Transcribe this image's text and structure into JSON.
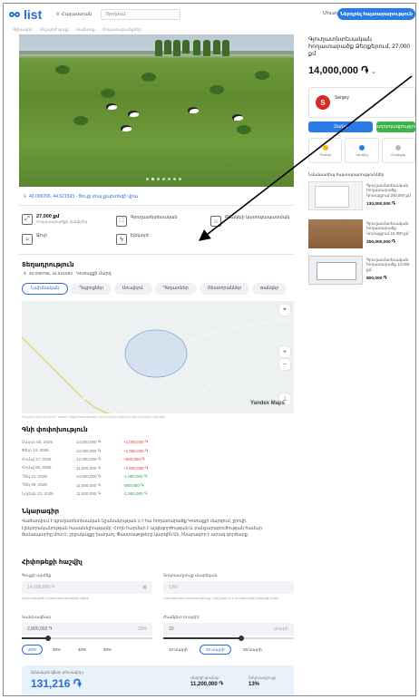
{
  "header": {
    "logo": "list",
    "location": "Հայաստան",
    "search_placeholder": "Որոնում",
    "login": "Մուտք",
    "post_button": "Ներդրել հայտարարություն"
  },
  "breadcrumbs": [
    "Գլխավոր",
    "Անշարժ գույք",
    "Վաճառք",
    "Հողատարածքներ"
  ],
  "coords_link": "40.099765, 44.621593 · Ցույց տալ քարտեզի վրա",
  "features": [
    {
      "title": "27,000 քմ",
      "sub": "Հողատարածքի մակերես"
    },
    {
      "title": "Գյուղատնտեսական",
      "sub": ""
    },
    {
      "title": "Բնակելի կառուցապատման",
      "sub": ""
    },
    {
      "title": "Ջուր",
      "sub": ""
    },
    {
      "title": "Էլեկտրէ",
      "sub": ""
    }
  ],
  "location_section": {
    "title": "Տեղադրություն",
    "address": "40.099765, 44.621593 · Կոտայքի մարզ",
    "chips": [
      "Նախնական",
      "Դպրոցներ",
      "Սուպերմ.",
      "Դեղատներ",
      "Ռեստորաններ",
      "Bանկեր"
    ],
    "map_brand": "Yandex Maps",
    "map_note": "Ինչպես նկատում եմ՝ Yandex Maps ծառայությունը հարմարավետ է տեղորոշելու համար"
  },
  "price_history": {
    "title": "Գնի փոփոխություն",
    "rows": [
      {
        "date": "Մարտ 05, 2026",
        "price": "14,000,000 ֏",
        "change": "+1,000,000 ֏",
        "dir": "up"
      },
      {
        "date": "Փետ 24, 2026",
        "price": "13,000,000 ֏",
        "change": "+1,000,000 ֏",
        "dir": "up"
      },
      {
        "date": "Հունվ 17, 2026",
        "price": "12,000,000 ֏",
        "change": "+500,000 ֏",
        "dir": "up"
      },
      {
        "date": "Հունվ 06, 2026",
        "price": "11,500,000 ֏",
        "change": "+1,500,000 ֏",
        "dir": "up"
      },
      {
        "date": "Դեկ 21, 2025",
        "price": "10,000,000 ֏",
        "change": "-1,000,000 ֏",
        "dir": "down"
      },
      {
        "date": "Դեկ 09, 2025",
        "price": "11,000,000 ֏",
        "change": "-500,000 ֏",
        "dir": "down"
      },
      {
        "date": "Նոյեմբ 22, 2025",
        "price": "11,500,000 ֏",
        "change": "-1,500,000 ֏",
        "dir": "down"
      }
    ]
  },
  "description": {
    "title": "Նկարագիր",
    "text": "Վաճառվում է գյուղատնտեսական նշանակության 2.7 հա հողատարածք Կոտայքի մարզում, ջրովի, էլեկտրականության հասանելիությամբ: Հողն հարմար է այգեգործության և բանջարաբուծության համար, ճանապարհը մոտ է, շրջակայքը խաղաղ: Փաստաթղթերը կարգին են, հնարավոր է արագ գործարք:"
  },
  "calculator": {
    "title": "Հիփոթեքի հաշվիչ",
    "price_label": "Գույքի արժեք",
    "price_value": "14,000,000 ֏",
    "price_hint": "Սահմանված է հայտարարության գնից",
    "rate_label": "Տոկոսադրույք տարեկան",
    "rate_value": "13%",
    "rate_hint": "Ստանդարտ տոկոսադրույք, որը կարող է տարբերվել բանկից բանկ",
    "down_label": "Կանխավճար",
    "down_value": "2,800,000 ֏",
    "down_suffix": "20%",
    "term_label": "Ժամկետ (տարի)",
    "term_value": "10",
    "term_suffix": "տարի",
    "down_pills": [
      "20%",
      "30%",
      "40%",
      "50%"
    ],
    "term_pills": [
      "10 տարի",
      "20 տարի",
      "30 տարի"
    ],
    "result_label": "Ամսական վճար (մոտավոր)",
    "result_value": "131,216 ֏",
    "loan_label": "Վարկի գումար",
    "loan_value": "11,200,000 ֏",
    "rate2_label": "Տոկոսադրույք",
    "rate2_value": "13%"
  },
  "sidebar": {
    "title": "Գյուղատնտեսական հողատարածք Ձեռքերում, 27,000 քմ",
    "price": "14,000,000 ֏",
    "seller_initial": "S",
    "seller_name": "Sergey",
    "call_button": "Զանգ",
    "message_button": "Հաղորդագրություն",
    "actions": [
      "Պահել",
      "Կիսվել",
      "Բողոքել"
    ],
    "similar_title": "Նմանատիպ հայտարարություններ",
    "similar": [
      {
        "title": "Գյուղատնտեսական հողատարածք Կոտայքում 200,000 քմ",
        "price": "130,000,000 ֏"
      },
      {
        "title": "Գյուղատնտեսական հողատարածք Կոտայքում 15,000 քմ",
        "price": "250,000,000 ֏"
      },
      {
        "title": "Գյուղատնտեսական հողատարածք 13,000 քմ",
        "price": "800,000 ֏"
      }
    ]
  },
  "colors": {
    "accent": "#2a7be4",
    "green": "#3bb54a",
    "red": "#e23838"
  }
}
